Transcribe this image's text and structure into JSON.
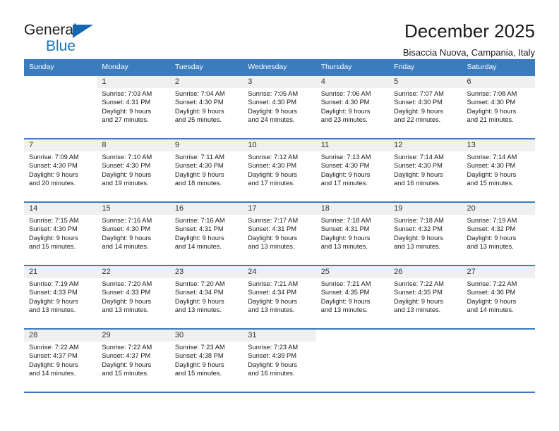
{
  "brand": {
    "name_part1": "General",
    "name_part2": "Blue",
    "logo_icon": "triangle-icon",
    "accent_color": "#1b75bb"
  },
  "header": {
    "title": "December 2025",
    "subtitle": "Bisaccia Nuova, Campania, Italy"
  },
  "calendar": {
    "header_bg": "#3a7cbe",
    "daynum_bg": "#f0f0f0",
    "weekday_headers": [
      "Sunday",
      "Monday",
      "Tuesday",
      "Wednesday",
      "Thursday",
      "Friday",
      "Saturday"
    ],
    "weeks": [
      [
        {
          "day": "",
          "sunrise": "",
          "sunset": "",
          "daylight_line1": "",
          "daylight_line2": ""
        },
        {
          "day": "1",
          "sunrise": "Sunrise: 7:03 AM",
          "sunset": "Sunset: 4:31 PM",
          "daylight_line1": "Daylight: 9 hours",
          "daylight_line2": "and 27 minutes."
        },
        {
          "day": "2",
          "sunrise": "Sunrise: 7:04 AM",
          "sunset": "Sunset: 4:30 PM",
          "daylight_line1": "Daylight: 9 hours",
          "daylight_line2": "and 25 minutes."
        },
        {
          "day": "3",
          "sunrise": "Sunrise: 7:05 AM",
          "sunset": "Sunset: 4:30 PM",
          "daylight_line1": "Daylight: 9 hours",
          "daylight_line2": "and 24 minutes."
        },
        {
          "day": "4",
          "sunrise": "Sunrise: 7:06 AM",
          "sunset": "Sunset: 4:30 PM",
          "daylight_line1": "Daylight: 9 hours",
          "daylight_line2": "and 23 minutes."
        },
        {
          "day": "5",
          "sunrise": "Sunrise: 7:07 AM",
          "sunset": "Sunset: 4:30 PM",
          "daylight_line1": "Daylight: 9 hours",
          "daylight_line2": "and 22 minutes."
        },
        {
          "day": "6",
          "sunrise": "Sunrise: 7:08 AM",
          "sunset": "Sunset: 4:30 PM",
          "daylight_line1": "Daylight: 9 hours",
          "daylight_line2": "and 21 minutes."
        }
      ],
      [
        {
          "day": "7",
          "sunrise": "Sunrise: 7:09 AM",
          "sunset": "Sunset: 4:30 PM",
          "daylight_line1": "Daylight: 9 hours",
          "daylight_line2": "and 20 minutes."
        },
        {
          "day": "8",
          "sunrise": "Sunrise: 7:10 AM",
          "sunset": "Sunset: 4:30 PM",
          "daylight_line1": "Daylight: 9 hours",
          "daylight_line2": "and 19 minutes."
        },
        {
          "day": "9",
          "sunrise": "Sunrise: 7:11 AM",
          "sunset": "Sunset: 4:30 PM",
          "daylight_line1": "Daylight: 9 hours",
          "daylight_line2": "and 18 minutes."
        },
        {
          "day": "10",
          "sunrise": "Sunrise: 7:12 AM",
          "sunset": "Sunset: 4:30 PM",
          "daylight_line1": "Daylight: 9 hours",
          "daylight_line2": "and 17 minutes."
        },
        {
          "day": "11",
          "sunrise": "Sunrise: 7:13 AM",
          "sunset": "Sunset: 4:30 PM",
          "daylight_line1": "Daylight: 9 hours",
          "daylight_line2": "and 17 minutes."
        },
        {
          "day": "12",
          "sunrise": "Sunrise: 7:14 AM",
          "sunset": "Sunset: 4:30 PM",
          "daylight_line1": "Daylight: 9 hours",
          "daylight_line2": "and 16 minutes."
        },
        {
          "day": "13",
          "sunrise": "Sunrise: 7:14 AM",
          "sunset": "Sunset: 4:30 PM",
          "daylight_line1": "Daylight: 9 hours",
          "daylight_line2": "and 15 minutes."
        }
      ],
      [
        {
          "day": "14",
          "sunrise": "Sunrise: 7:15 AM",
          "sunset": "Sunset: 4:30 PM",
          "daylight_line1": "Daylight: 9 hours",
          "daylight_line2": "and 15 minutes."
        },
        {
          "day": "15",
          "sunrise": "Sunrise: 7:16 AM",
          "sunset": "Sunset: 4:30 PM",
          "daylight_line1": "Daylight: 9 hours",
          "daylight_line2": "and 14 minutes."
        },
        {
          "day": "16",
          "sunrise": "Sunrise: 7:16 AM",
          "sunset": "Sunset: 4:31 PM",
          "daylight_line1": "Daylight: 9 hours",
          "daylight_line2": "and 14 minutes."
        },
        {
          "day": "17",
          "sunrise": "Sunrise: 7:17 AM",
          "sunset": "Sunset: 4:31 PM",
          "daylight_line1": "Daylight: 9 hours",
          "daylight_line2": "and 13 minutes."
        },
        {
          "day": "18",
          "sunrise": "Sunrise: 7:18 AM",
          "sunset": "Sunset: 4:31 PM",
          "daylight_line1": "Daylight: 9 hours",
          "daylight_line2": "and 13 minutes."
        },
        {
          "day": "19",
          "sunrise": "Sunrise: 7:18 AM",
          "sunset": "Sunset: 4:32 PM",
          "daylight_line1": "Daylight: 9 hours",
          "daylight_line2": "and 13 minutes."
        },
        {
          "day": "20",
          "sunrise": "Sunrise: 7:19 AM",
          "sunset": "Sunset: 4:32 PM",
          "daylight_line1": "Daylight: 9 hours",
          "daylight_line2": "and 13 minutes."
        }
      ],
      [
        {
          "day": "21",
          "sunrise": "Sunrise: 7:19 AM",
          "sunset": "Sunset: 4:33 PM",
          "daylight_line1": "Daylight: 9 hours",
          "daylight_line2": "and 13 minutes."
        },
        {
          "day": "22",
          "sunrise": "Sunrise: 7:20 AM",
          "sunset": "Sunset: 4:33 PM",
          "daylight_line1": "Daylight: 9 hours",
          "daylight_line2": "and 13 minutes."
        },
        {
          "day": "23",
          "sunrise": "Sunrise: 7:20 AM",
          "sunset": "Sunset: 4:34 PM",
          "daylight_line1": "Daylight: 9 hours",
          "daylight_line2": "and 13 minutes."
        },
        {
          "day": "24",
          "sunrise": "Sunrise: 7:21 AM",
          "sunset": "Sunset: 4:34 PM",
          "daylight_line1": "Daylight: 9 hours",
          "daylight_line2": "and 13 minutes."
        },
        {
          "day": "25",
          "sunrise": "Sunrise: 7:21 AM",
          "sunset": "Sunset: 4:35 PM",
          "daylight_line1": "Daylight: 9 hours",
          "daylight_line2": "and 13 minutes."
        },
        {
          "day": "26",
          "sunrise": "Sunrise: 7:22 AM",
          "sunset": "Sunset: 4:35 PM",
          "daylight_line1": "Daylight: 9 hours",
          "daylight_line2": "and 13 minutes."
        },
        {
          "day": "27",
          "sunrise": "Sunrise: 7:22 AM",
          "sunset": "Sunset: 4:36 PM",
          "daylight_line1": "Daylight: 9 hours",
          "daylight_line2": "and 14 minutes."
        }
      ],
      [
        {
          "day": "28",
          "sunrise": "Sunrise: 7:22 AM",
          "sunset": "Sunset: 4:37 PM",
          "daylight_line1": "Daylight: 9 hours",
          "daylight_line2": "and 14 minutes."
        },
        {
          "day": "29",
          "sunrise": "Sunrise: 7:22 AM",
          "sunset": "Sunset: 4:37 PM",
          "daylight_line1": "Daylight: 9 hours",
          "daylight_line2": "and 15 minutes."
        },
        {
          "day": "30",
          "sunrise": "Sunrise: 7:23 AM",
          "sunset": "Sunset: 4:38 PM",
          "daylight_line1": "Daylight: 9 hours",
          "daylight_line2": "and 15 minutes."
        },
        {
          "day": "31",
          "sunrise": "Sunrise: 7:23 AM",
          "sunset": "Sunset: 4:39 PM",
          "daylight_line1": "Daylight: 9 hours",
          "daylight_line2": "and 16 minutes."
        },
        {
          "day": "",
          "sunrise": "",
          "sunset": "",
          "daylight_line1": "",
          "daylight_line2": ""
        },
        {
          "day": "",
          "sunrise": "",
          "sunset": "",
          "daylight_line1": "",
          "daylight_line2": ""
        },
        {
          "day": "",
          "sunrise": "",
          "sunset": "",
          "daylight_line1": "",
          "daylight_line2": ""
        }
      ]
    ]
  }
}
